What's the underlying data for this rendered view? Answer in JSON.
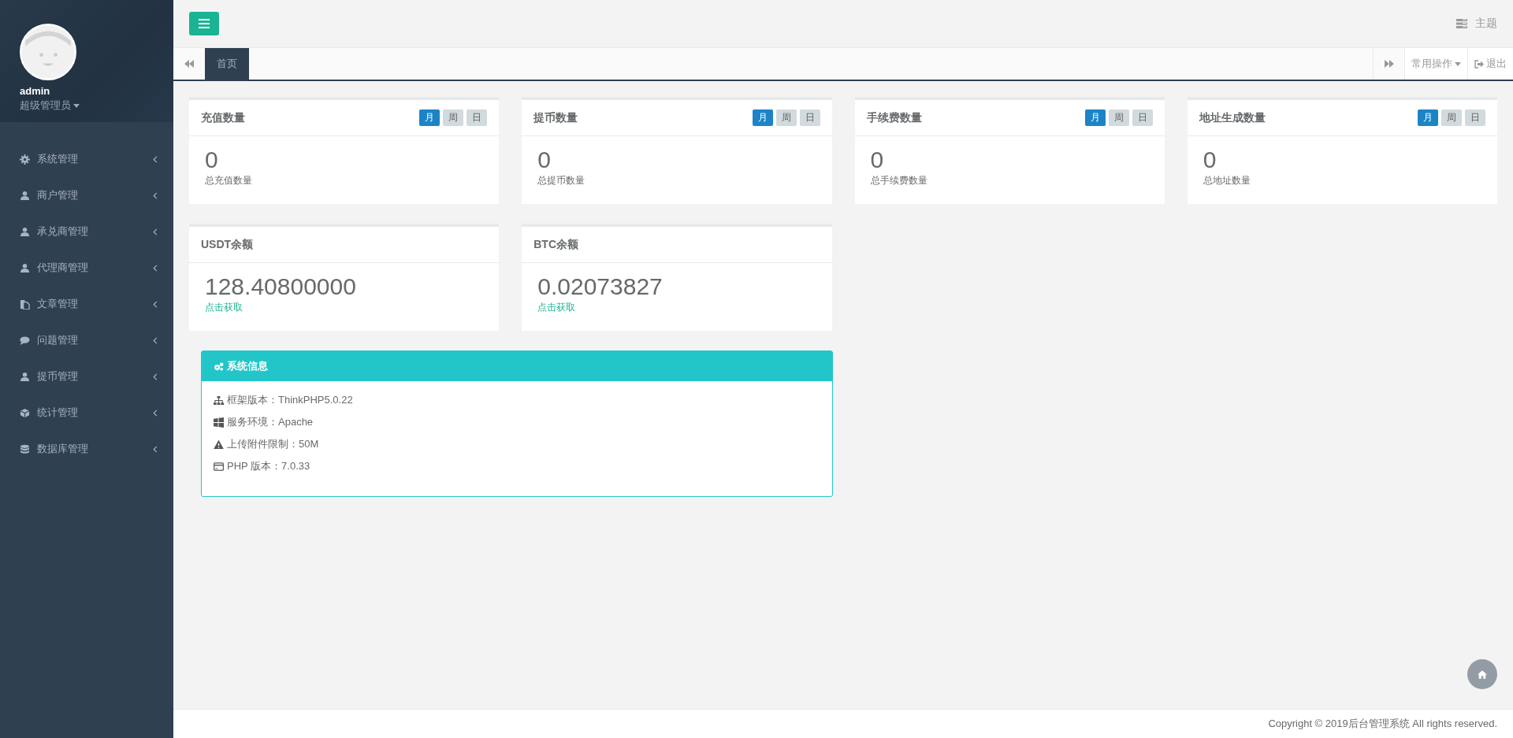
{
  "sidebar": {
    "profile": {
      "name": "admin",
      "role": "超级管理员"
    },
    "menu": [
      {
        "label": "系统管理",
        "kind": "gear"
      },
      {
        "label": "商户管理",
        "kind": "user"
      },
      {
        "label": "承兑商管理",
        "kind": "user"
      },
      {
        "label": "代理商管理",
        "kind": "user"
      },
      {
        "label": "文章管理",
        "kind": "copy"
      },
      {
        "label": "问题管理",
        "kind": "comment"
      },
      {
        "label": "提币管理",
        "kind": "user"
      },
      {
        "label": "统计管理",
        "kind": "cube"
      },
      {
        "label": "数据库管理",
        "kind": "database"
      }
    ]
  },
  "topbar": {
    "theme": "主题"
  },
  "tabs": {
    "items": [
      {
        "label": "首页",
        "selected": true
      }
    ],
    "common_ops": "常用操作",
    "logout": "退出"
  },
  "stat_cards": [
    {
      "title": "充值数量",
      "periods": [
        {
          "label": "月",
          "selected": true
        },
        {
          "label": "周",
          "selected": false
        },
        {
          "label": "日",
          "selected": false
        }
      ],
      "value": "0",
      "caption": "总充值数量"
    },
    {
      "title": "提币数量",
      "periods": [
        {
          "label": "月",
          "selected": true
        },
        {
          "label": "周",
          "selected": false
        },
        {
          "label": "日",
          "selected": false
        }
      ],
      "value": "0",
      "caption": "总提币数量"
    },
    {
      "title": "手续费数量",
      "periods": [
        {
          "label": "月",
          "selected": true
        },
        {
          "label": "周",
          "selected": false
        },
        {
          "label": "日",
          "selected": false
        }
      ],
      "value": "0",
      "caption": "总手续费数量"
    },
    {
      "title": "地址生成数量",
      "periods": [
        {
          "label": "月",
          "selected": true
        },
        {
          "label": "周",
          "selected": false
        },
        {
          "label": "日",
          "selected": false
        }
      ],
      "value": "0",
      "caption": "总地址数量"
    }
  ],
  "balance_cards": [
    {
      "title": "USDT余额",
      "value": "128.40800000",
      "link": "点击获取"
    },
    {
      "title": "BTC余额",
      "value": "0.02073827",
      "link": "点击获取"
    }
  ],
  "system_info": {
    "title": "系统信息",
    "items": [
      {
        "kind": "sitemap",
        "text": "框架版本：ThinkPHP5.0.22"
      },
      {
        "kind": "windows",
        "text": "服务环境：Apache"
      },
      {
        "kind": "warning",
        "text": "上传附件限制：50M"
      },
      {
        "kind": "card",
        "text": "PHP 版本：7.0.33"
      }
    ]
  },
  "footer": "Copyright © 2019后台管理系统 All rights reserved."
}
